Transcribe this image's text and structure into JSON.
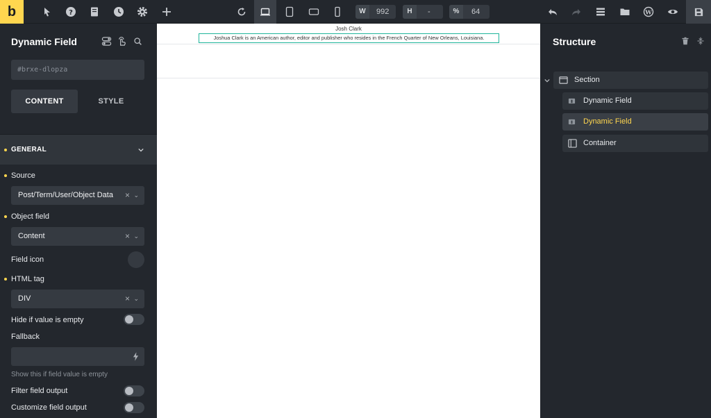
{
  "app": {
    "logo_letter": "b"
  },
  "toolbar": {
    "icons": [
      "pointer-icon",
      "help-icon",
      "pages-icon",
      "history-icon",
      "settings-icon",
      "add-icon"
    ],
    "breakpoints": [
      "refresh-icon",
      "desktop-icon",
      "tablet-portrait-icon",
      "tablet-landscape-icon",
      "mobile-icon"
    ],
    "width": {
      "label": "W",
      "value": "992"
    },
    "height": {
      "label": "H",
      "value": "-"
    },
    "zoom": {
      "label": "%",
      "value": "64"
    },
    "right_icons": [
      "undo-icon",
      "redo-icon",
      "structure-icon",
      "folder-icon",
      "wordpress-icon",
      "preview-icon",
      "save-icon"
    ]
  },
  "left_panel": {
    "title": "Dynamic Field",
    "element_id": "#brxe-dlopza",
    "tabs": {
      "content": "CONTENT",
      "style": "STYLE"
    },
    "group": "GENERAL",
    "source": {
      "label": "Source",
      "value": "Post/Term/User/Object Data"
    },
    "object_field": {
      "label": "Object field",
      "value": "Content"
    },
    "field_icon": {
      "label": "Field icon"
    },
    "html_tag": {
      "label": "HTML tag",
      "value": "DIV"
    },
    "hide_if_empty": {
      "label": "Hide if value is empty",
      "on": false
    },
    "fallback": {
      "label": "Fallback",
      "value": "",
      "hint": "Show this if field value is empty"
    },
    "filter_output": {
      "label": "Filter field output",
      "on": false
    },
    "customize_output": {
      "label": "Customize field output",
      "on": false
    },
    "clear_symbol": "×",
    "chevron_symbol": "⌄"
  },
  "canvas": {
    "heading": "Josh Clark",
    "text": "Joshua Clark is an American author, editor and publisher who resides in the French Quarter of New Orleans, Louisiana."
  },
  "right_panel": {
    "title": "Structure",
    "tree": [
      {
        "label": "Section",
        "icon": "section-icon",
        "selected": false
      },
      {
        "label": "Dynamic Field",
        "icon": "dynamic-field-icon",
        "selected": false
      },
      {
        "label": "Dynamic Field",
        "icon": "dynamic-field-icon",
        "selected": true
      },
      {
        "label": "Container",
        "icon": "container-icon",
        "selected": false
      }
    ]
  },
  "colors": {
    "accent": "#ffd64f",
    "panel": "#23272d",
    "control": "#353a41",
    "selection_border": "#1fb59b"
  }
}
